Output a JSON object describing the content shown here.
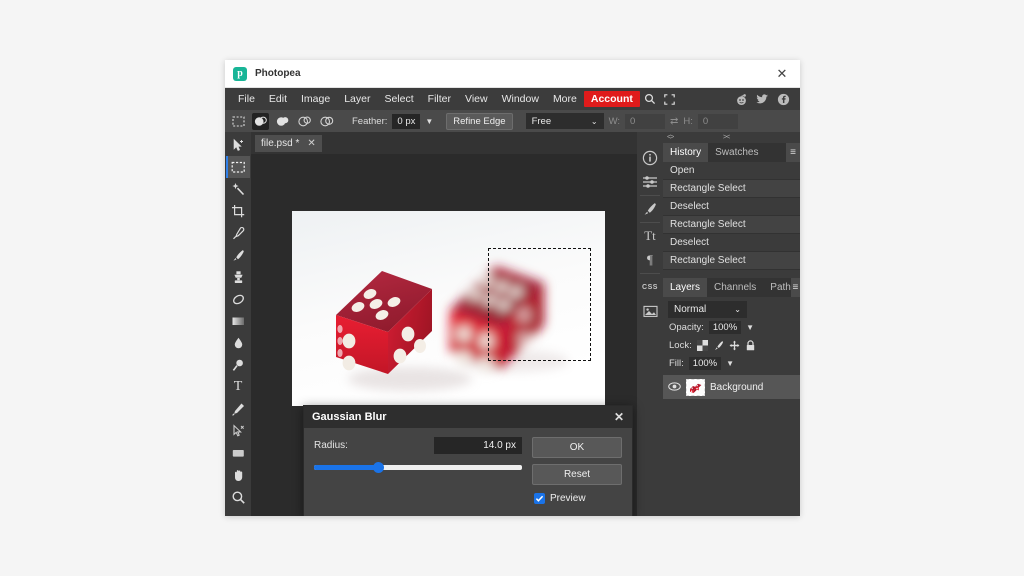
{
  "window": {
    "title": "Photopea",
    "logo_letter": "p",
    "close_label": "✕"
  },
  "menubar": {
    "items": [
      "File",
      "Edit",
      "Image",
      "Layer",
      "Select",
      "Filter",
      "View",
      "Window",
      "More"
    ],
    "account_label": "Account",
    "icons": [
      "search-icon",
      "fullscreen-icon"
    ],
    "social": [
      "reddit-icon",
      "twitter-icon",
      "facebook-icon"
    ],
    "accent_color": "#e01b1b"
  },
  "options_bar": {
    "tool_icon": "rectangle-marquee-icon",
    "bool_modes": [
      "new-selection",
      "add-to-selection",
      "subtract-from-selection",
      "intersect-selection"
    ],
    "active_bool_mode": 0,
    "feather_label": "Feather:",
    "feather_value": "0 px",
    "refine_edge_label": "Refine Edge",
    "style_value": "Free",
    "width_label": "W:",
    "width_value": "0",
    "swap_icon": "swap-arrows-icon",
    "height_label": "H:",
    "height_value": "0"
  },
  "toolbar": {
    "tools": [
      {
        "name": "move-tool",
        "glyph": "move"
      },
      {
        "name": "rectangle-marquee-tool",
        "glyph": "marquee",
        "active": true
      },
      {
        "name": "magic-wand-tool",
        "glyph": "wand"
      },
      {
        "name": "crop-tool",
        "glyph": "crop"
      },
      {
        "name": "eyedropper-tool",
        "glyph": "dropper"
      },
      {
        "name": "brush-tool",
        "glyph": "brush"
      },
      {
        "name": "clone-stamp-tool",
        "glyph": "stamp"
      },
      {
        "name": "eraser-tool",
        "glyph": "eraser"
      },
      {
        "name": "gradient-tool",
        "glyph": "gradient"
      },
      {
        "name": "blur-tool",
        "glyph": "blur"
      },
      {
        "name": "dodge-tool",
        "glyph": "dodge"
      },
      {
        "name": "type-tool",
        "glyph": "type"
      },
      {
        "name": "pen-tool",
        "glyph": "pen"
      },
      {
        "name": "path-select-tool",
        "glyph": "pathselect"
      },
      {
        "name": "shape-tool",
        "glyph": "shape"
      },
      {
        "name": "hand-tool",
        "glyph": "hand"
      },
      {
        "name": "zoom-tool",
        "glyph": "zoom"
      }
    ]
  },
  "document": {
    "tab_label": "file.psd *",
    "tab_close": "✕"
  },
  "right_rail": {
    "icons": [
      "info-icon",
      "adjustments-icon",
      "brush-settings-icon",
      "character-icon",
      "paragraph-icon",
      "css-icon",
      "image-icon"
    ],
    "css_label": "CSS"
  },
  "panels": {
    "collapse_left": "<>",
    "collapse_right": "><",
    "burger": "≡",
    "history": {
      "tabs": [
        "History",
        "Swatches"
      ],
      "active_tab": "History",
      "items": [
        "Open",
        "Rectangle Select",
        "Deselect",
        "Rectangle Select",
        "Deselect",
        "Rectangle Select"
      ]
    },
    "layers": {
      "tabs": [
        "Layers",
        "Channels",
        "Path"
      ],
      "active_tab": "Layers",
      "blend_mode": "Normal",
      "opacity_label": "Opacity:",
      "opacity_value": "100%",
      "lock_label": "Lock:",
      "lock_icons": [
        "lock-transparency-icon",
        "lock-pixels-icon",
        "lock-position-icon",
        "lock-all-icon"
      ],
      "fill_label": "Fill:",
      "fill_value": "100%",
      "rows": [
        {
          "name": "Background",
          "visible": true,
          "thumb": "dice-thumbnail"
        }
      ]
    }
  },
  "dialog": {
    "title": "Gaussian Blur",
    "close_label": "✕",
    "radius_label": "Radius:",
    "radius_value": "14.0 px",
    "slider_percent": 31,
    "ok_label": "OK",
    "reset_label": "Reset",
    "preview_label": "Preview",
    "preview_checked": true,
    "accent_color": "#1a73e8"
  },
  "canvas": {
    "description": "two red translucent dice on white background",
    "selection": "rectangular-marquee-around-right-die",
    "blurred_region": "right-die"
  }
}
